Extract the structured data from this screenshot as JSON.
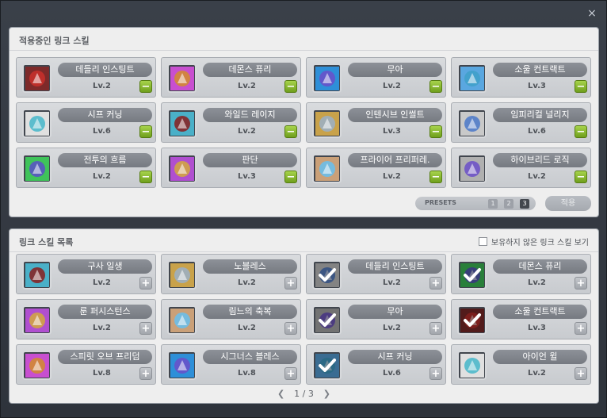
{
  "window": {
    "close_label": "×"
  },
  "applied": {
    "title": "적용중인 링크 스킬",
    "skills": [
      {
        "name": "데들리 인스팅트",
        "level": "Lv.2",
        "icon": "deadly-instinct-icon"
      },
      {
        "name": "데몬스 퓨리",
        "level": "Lv.2",
        "icon": "demons-fury-icon"
      },
      {
        "name": "무아",
        "level": "Lv.2",
        "icon": "mua-icon"
      },
      {
        "name": "소울 컨트랙트",
        "level": "Lv.3",
        "icon": "soul-contract-icon"
      },
      {
        "name": "시프 커닝",
        "level": "Lv.6",
        "icon": "thief-cunning-icon"
      },
      {
        "name": "와일드 레이지",
        "level": "Lv.2",
        "icon": "wild-rage-icon"
      },
      {
        "name": "인텐시브 인썰트",
        "level": "Lv.3",
        "icon": "intensive-insult-icon"
      },
      {
        "name": "임피리컬 널리지",
        "level": "Lv.6",
        "icon": "empirical-knowledge-icon"
      },
      {
        "name": "전투의 흐름",
        "level": "Lv.2",
        "icon": "flow-of-battle-icon"
      },
      {
        "name": "판단",
        "level": "Lv.3",
        "icon": "judgement-icon"
      },
      {
        "name": "프라이어 프리퍼레.",
        "level": "Lv.2",
        "icon": "prior-preparation-icon"
      },
      {
        "name": "하이브리드 로직",
        "level": "Lv.2",
        "icon": "hybrid-logic-icon"
      }
    ],
    "remove_label": "−",
    "presets": {
      "label": "PRESETS",
      "items": [
        "1",
        "2",
        "3"
      ],
      "active": "3"
    },
    "apply_label": "적용"
  },
  "list": {
    "title": "링크 스킬 목록",
    "show_unowned_label": "보유하지 않은 링크 스킬 보기",
    "skills": [
      {
        "name": "구사 일생",
        "level": "Lv.2",
        "icon": "narrow-escape-icon",
        "checked": false
      },
      {
        "name": "노블레스",
        "level": "Lv.2",
        "icon": "noblesse-icon",
        "checked": false
      },
      {
        "name": "데들리 인스팅트",
        "level": "Lv.2",
        "icon": "deadly-instinct-icon",
        "checked": true
      },
      {
        "name": "데몬스 퓨리",
        "level": "Lv.2",
        "icon": "demons-fury-icon",
        "checked": true
      },
      {
        "name": "룬 퍼시스턴스",
        "level": "Lv.2",
        "icon": "rune-persistence-icon",
        "checked": false
      },
      {
        "name": "림느의 축복",
        "level": "Lv.2",
        "icon": "rimnes-blessing-icon",
        "checked": false
      },
      {
        "name": "무아",
        "level": "Lv.2",
        "icon": "mua-icon",
        "checked": true
      },
      {
        "name": "소울 컨트랙트",
        "level": "Lv.3",
        "icon": "soul-contract-icon",
        "checked": true
      },
      {
        "name": "스피릿 오브 프리덤",
        "level": "Lv.8",
        "icon": "spirit-of-freedom-icon",
        "checked": false
      },
      {
        "name": "시그너스 블레스",
        "level": "Lv.8",
        "icon": "cygnus-bless-icon",
        "checked": false
      },
      {
        "name": "시프 커닝",
        "level": "Lv.6",
        "icon": "thief-cunning-icon",
        "checked": true
      },
      {
        "name": "아이언 윌",
        "level": "Lv.2",
        "icon": "iron-will-icon",
        "checked": false
      }
    ],
    "add_label": "+",
    "pager": {
      "prev": "❮",
      "current": "1",
      "separator": "/",
      "total": "3",
      "next": "❯"
    }
  },
  "colors": {
    "icon_palette": [
      "#c9302c",
      "#7e2a2a",
      "#d28c2a",
      "#c84fd0",
      "#6b4fc9",
      "#2e8fd8",
      "#3fa0c8",
      "#5aa7e0",
      "#44b6c9",
      "#e0e0e0",
      "#8a1d1d",
      "#4ab0c8",
      "#9ab0c8",
      "#c9a24a",
      "#4a78c9",
      "#c9c9c9",
      "#5b4fc9",
      "#3fc35a",
      "#d4a93c",
      "#b04fd0",
      "#66c0f0",
      "#caa078",
      "#6b4fc9",
      "#b0b0b0"
    ]
  }
}
